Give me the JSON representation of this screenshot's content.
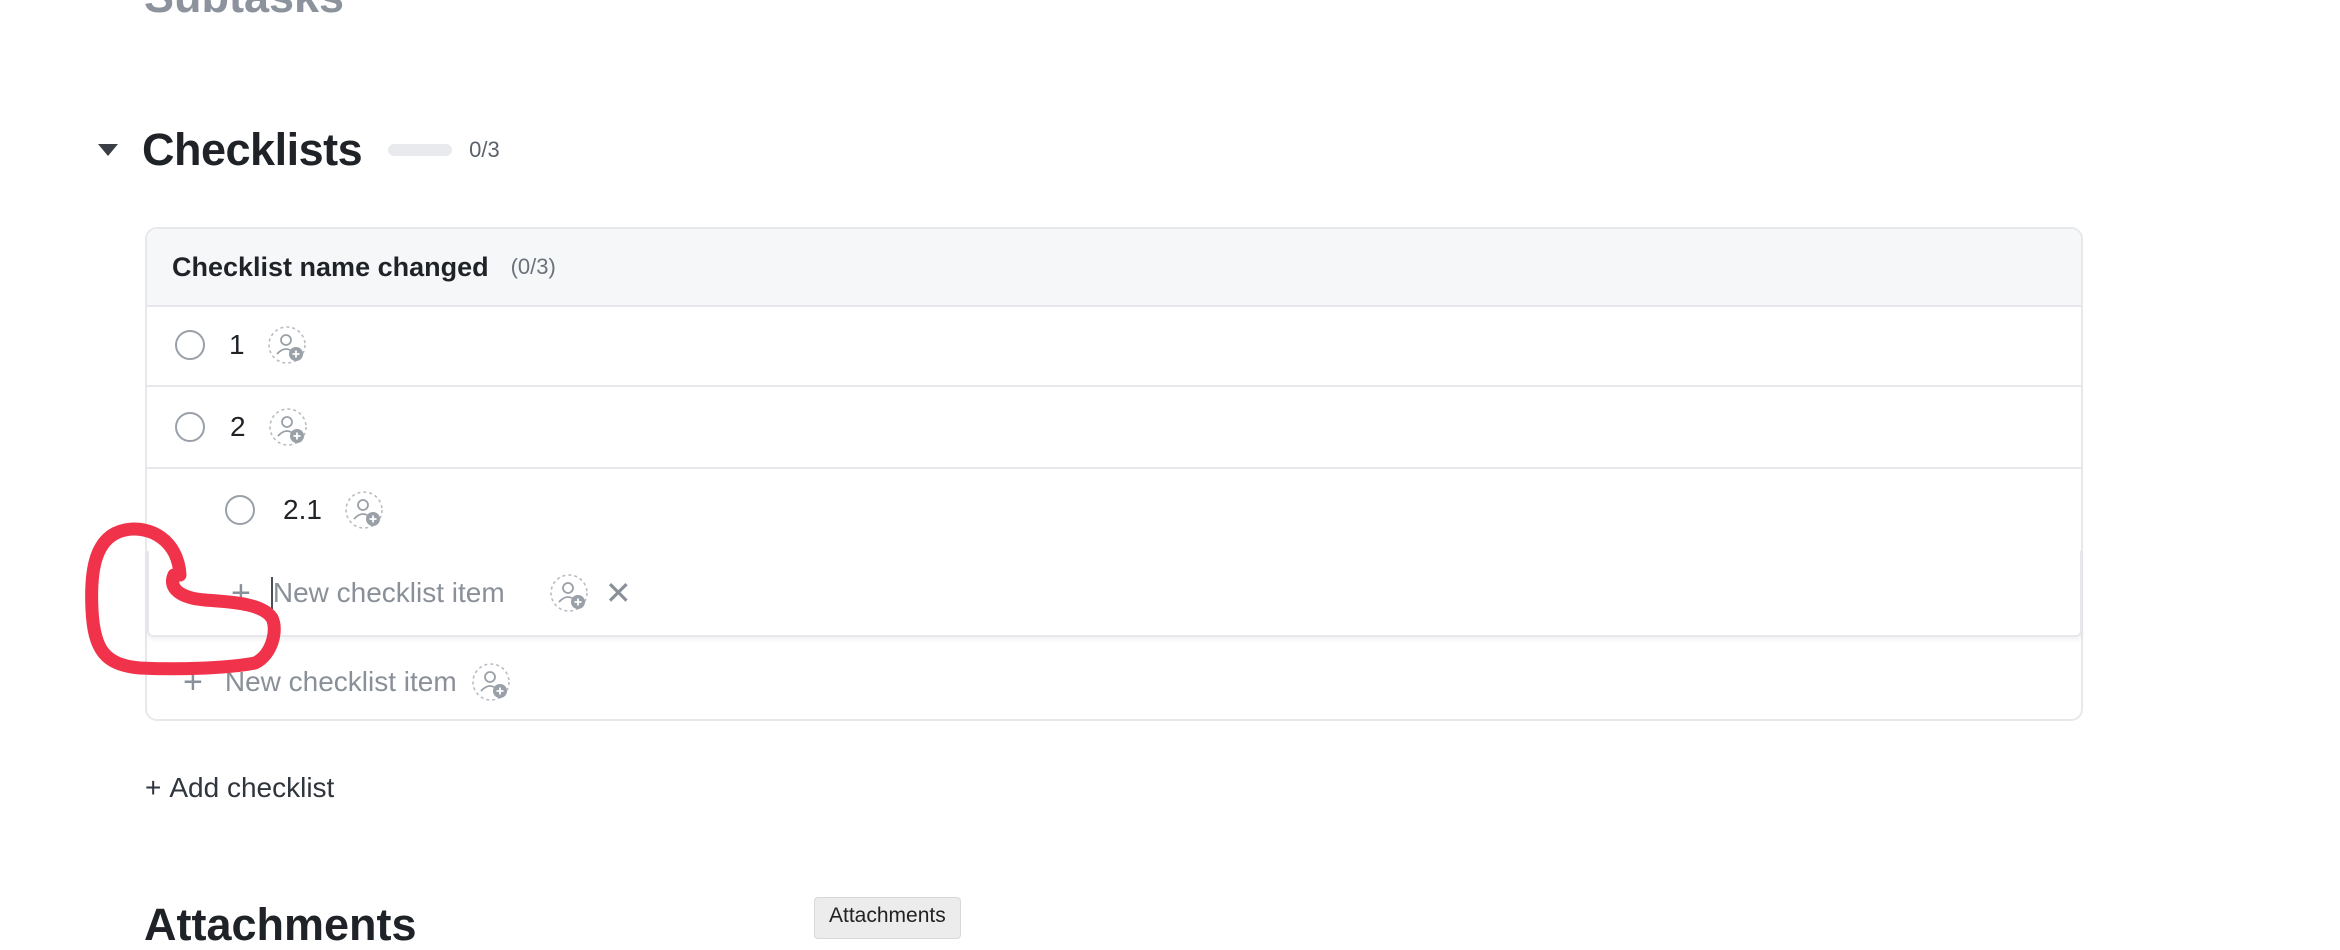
{
  "subtasks_heading": "Subtasks",
  "checklists": {
    "title": "Checklists",
    "progress_text": "0/3",
    "progress_fraction": 0,
    "card": {
      "title": "Checklist name changed",
      "count": "(0/3)",
      "items": [
        {
          "label": "1"
        },
        {
          "label": "2"
        },
        {
          "label": "2.1"
        }
      ],
      "editor": {
        "placeholder": "New checklist item",
        "value": ""
      },
      "new_item_text": "New checklist item"
    },
    "add_checklist_label": "Add checklist",
    "add_checklist_prefix": "+"
  },
  "attachments_heading": "Attachments",
  "tooltip_text": "Attachments",
  "icons": {
    "collapse": "caret-down-icon",
    "assign": "assign-user-icon",
    "add": "plus-icon",
    "close": "close-icon"
  },
  "colors": {
    "accent": "#4a90e2",
    "annotation": "#f0334a"
  }
}
